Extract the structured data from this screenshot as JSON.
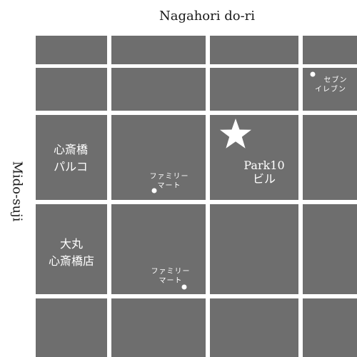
{
  "roads": {
    "top": "Nagahori do-ri",
    "left": "Mido-suji"
  },
  "places": {
    "shinsaibashi_parco": {
      "line1": "心斎橋",
      "line2": "パルコ"
    },
    "daimaru": {
      "line1": "大丸",
      "line2": "心斎橋店"
    },
    "park10": {
      "line1": "Park10",
      "line2": "ビル"
    },
    "family_mart_1": {
      "line1": "ファミリー",
      "line2": "マート"
    },
    "family_mart_2": {
      "line1": "ファミリー",
      "line2": "マート"
    },
    "seven_eleven": {
      "line1": "セブン",
      "line2": "イレブン"
    }
  },
  "colors": {
    "block": "#6e6e6e",
    "road": "#ffffff",
    "label": "#ffffff",
    "road_label": "#1a1a1a"
  },
  "markers": {
    "destination": "star-icon",
    "store": "dot-icon"
  }
}
